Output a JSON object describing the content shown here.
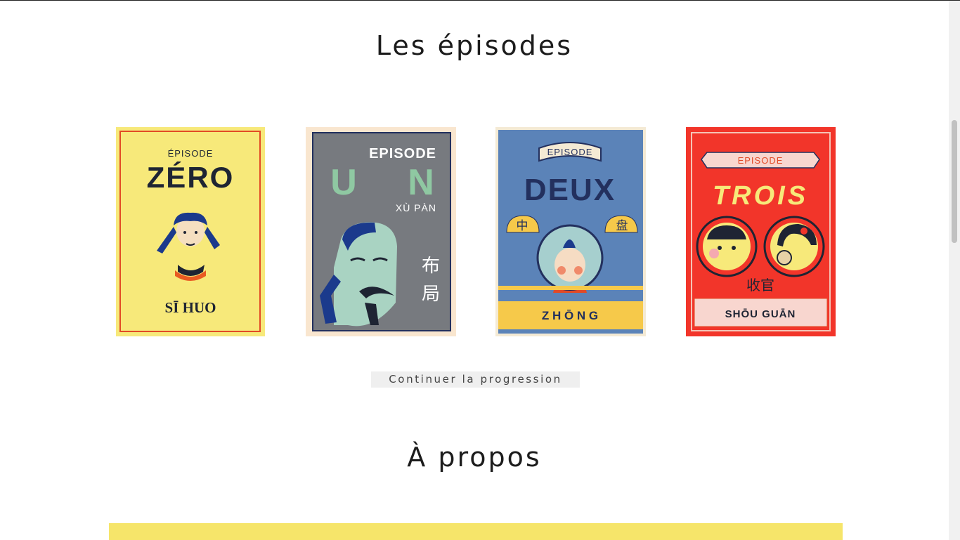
{
  "episodes_section": {
    "title": "Les épisodes"
  },
  "cards": [
    {
      "id": "zero",
      "episode_label": "ÉPISODE",
      "number": "ZÉRO",
      "subtitle": "SĪ HUO"
    },
    {
      "id": "un",
      "episode_label": "EPISODE",
      "number_letters": [
        "U",
        "N"
      ],
      "subtitle": "XÙ PÀN",
      "chinese": [
        "布",
        "局"
      ]
    },
    {
      "id": "deux",
      "episode_label": "EPISODE",
      "number": "DEUX",
      "chinese_left": "中",
      "chinese_right": "盘",
      "subtitle": "Z H Ō N G"
    },
    {
      "id": "trois",
      "episode_label": "EPISODE",
      "number": "TROIS",
      "chinese": "收官",
      "subtitle": "SHŌU GUĀN"
    }
  ],
  "continue_button": {
    "label": "Continuer la progression"
  },
  "about_section": {
    "title": "À propos"
  },
  "colors": {
    "zero_bg": "#f7e97a",
    "zero_border": "#e24a26",
    "un_bg": "#777a7f",
    "un_frame": "#f9e6cf",
    "deux_bg": "#5b83b8",
    "deux_band": "#f6c94a",
    "trois_bg": "#f2352a",
    "about_band": "#f6e56a"
  }
}
